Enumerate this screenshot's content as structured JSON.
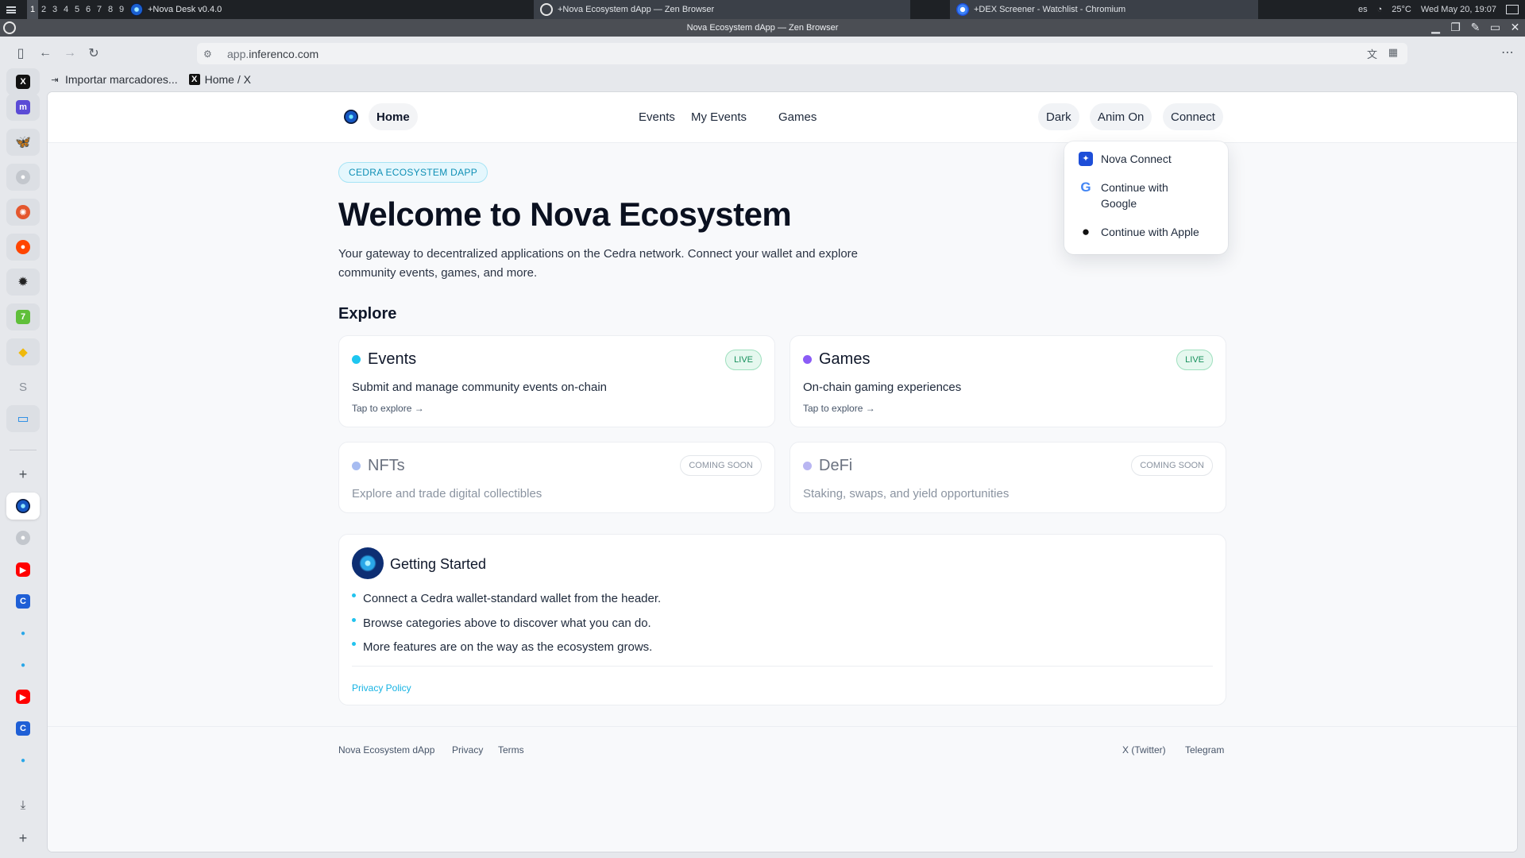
{
  "os_bar": {
    "workspaces": [
      "1",
      "2",
      "3",
      "4",
      "5",
      "6",
      "7",
      "8",
      "9"
    ],
    "tasks": [
      {
        "label": "+Nova Desk v0.4.0"
      },
      {
        "label": "+Nova Ecosystem dApp — Zen Browser"
      },
      {
        "label": "+DEX Screener - Watchlist - Chromium"
      }
    ],
    "lang": "es",
    "temperature": "25°C",
    "datetime": "Wed May 20, 19:07"
  },
  "window": {
    "title": "Nova Ecosystem dApp — Zen Browser"
  },
  "browser": {
    "url_host_dim": "app.",
    "url_host": "inferenco.com",
    "bookmarks": [
      {
        "label": "Importar marcadores..."
      },
      {
        "label": "Home / X"
      }
    ]
  },
  "sidebar": {
    "colors": {
      "x": "#111111",
      "mastodon": "#5b4bd6",
      "bluesky": "#1a8cf0",
      "github": "#aab0b8",
      "pinwheel": "#e4572e",
      "reddit": "#ff4500",
      "dark": "#222222",
      "green": "#5fbf3a",
      "binance": "#f0b90b",
      "folder": "#1e88e5",
      "youtube": "#ff0000",
      "c": "#1f5fd6",
      "drop": "#2aa7e8"
    },
    "letter_s": "S"
  },
  "site": {
    "nav": {
      "home": "Home",
      "events": "Events",
      "my_events": "My Events",
      "games": "Games",
      "dark": "Dark",
      "anim": "Anim On",
      "connect": "Connect"
    },
    "badge": "CEDRA ECOSYSTEM DAPP",
    "title": "Welcome to Nova Ecosystem",
    "subtitle": "Your gateway to decentralized applications on the Cedra network. Connect your wallet and explore community events, games, and more.",
    "explore_heading": "Explore",
    "cards": [
      {
        "title": "Events",
        "desc": "Submit and manage community events on-chain",
        "link": "Tap to explore →",
        "tag": "LIVE",
        "dot": "#1ec6f0"
      },
      {
        "title": "Games",
        "desc": "On-chain gaming experiences",
        "link": "Tap to explore →",
        "tag": "LIVE",
        "dot": "#8b5cf6"
      },
      {
        "title": "NFTs",
        "desc": "Explore and trade digital collectibles",
        "tag": "COMING SOON",
        "dot": "#6d8fe8"
      },
      {
        "title": "DeFi",
        "desc": "Staking, swaps, and yield opportunities",
        "tag": "COMING SOON",
        "dot": "#8b86ea"
      }
    ],
    "getting_started": {
      "title": "Getting Started",
      "items": [
        "Connect a Cedra wallet-standard wallet from the header.",
        "Browse categories above to discover what you can do.",
        "More features are on the way as the ecosystem grows."
      ],
      "privacy": "Privacy Policy"
    },
    "footer": {
      "brand": "Nova Ecosystem dApp",
      "privacy": "Privacy",
      "terms": "Terms",
      "twitter": "X (Twitter)",
      "telegram": "Telegram"
    },
    "connect_menu": [
      {
        "label": "Nova Connect"
      },
      {
        "label": "Continue with Google"
      },
      {
        "label": "Continue with Apple"
      }
    ]
  }
}
